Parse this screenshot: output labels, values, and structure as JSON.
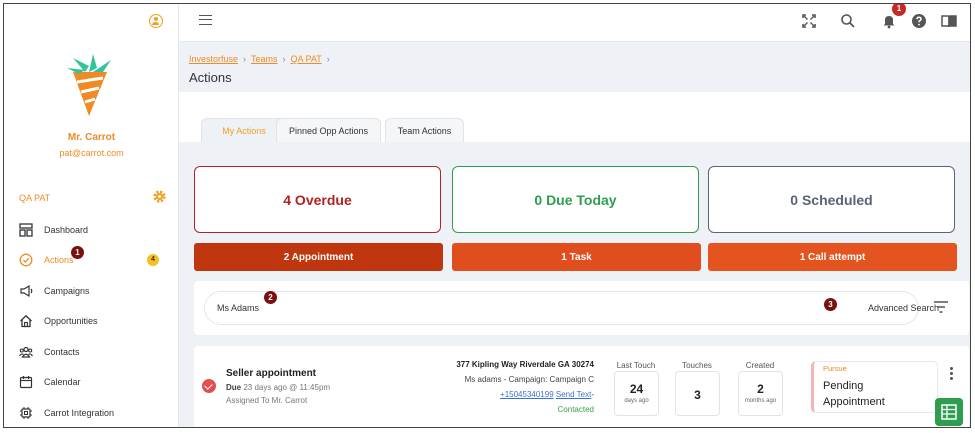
{
  "sidebar": {
    "user_name": "Mr. Carrot",
    "user_email": "pat@carrot.com",
    "team_name": "QA PAT",
    "items": [
      {
        "label": "Dashboard",
        "icon": "dashboard-icon"
      },
      {
        "label": "Actions",
        "icon": "check-circle-icon",
        "badge": "4"
      },
      {
        "label": "Campaigns",
        "icon": "megaphone-icon"
      },
      {
        "label": "Opportunities",
        "icon": "home-icon"
      },
      {
        "label": "Contacts",
        "icon": "contacts-icon"
      },
      {
        "label": "Calendar",
        "icon": "calendar-icon"
      },
      {
        "label": "Carrot Integration",
        "icon": "integration-icon"
      }
    ]
  },
  "topbar": {
    "notification_count": "1"
  },
  "breadcrumb": [
    "Investorfuse",
    "Teams",
    "QA PAT"
  ],
  "page_title": "Actions",
  "tabs": [
    "My Actions",
    "Pinned Opp Actions",
    "Team Actions"
  ],
  "stats": {
    "overdue": "4 Overdue",
    "due_today": "0 Due Today",
    "scheduled": "0 Scheduled"
  },
  "action_types": [
    "2 Appointment",
    "1 Task",
    "1 Call attempt"
  ],
  "search": {
    "value": "Ms Adams",
    "advanced_label": "Advanced Search"
  },
  "markers": [
    "1",
    "2",
    "3"
  ],
  "action": {
    "title": "Seller appointment",
    "due_label": "Due",
    "due_time": "23 days ago @ 11:45pm",
    "assigned": "Assigned To Mr. Carrot",
    "address": "377 Kipling Way Riverdale GA 30274",
    "contact_campaign": "Ms adams - Campaign: Campaign C",
    "phone": "+15045340199",
    "send_text": "Send Text",
    "contact_status": "Contacted",
    "last_touch_label": "Last Touch",
    "last_touch_value": "24",
    "last_touch_unit": "days ago",
    "touches_label": "Touches",
    "touches_value": "3",
    "created_label": "Created",
    "created_value": "2",
    "created_unit": "months ago",
    "status_tag": "Pursue",
    "status_line1": "Pending",
    "status_line2": "Appointment"
  },
  "colors": {
    "accent": "#f08a24",
    "overdue": "#b22222",
    "due_today": "#2e9d4f",
    "scheduled": "#5a6478",
    "appointment_bar": "#c0360f",
    "task_bar": "#e04e1e",
    "call_bar": "#e4541f"
  }
}
